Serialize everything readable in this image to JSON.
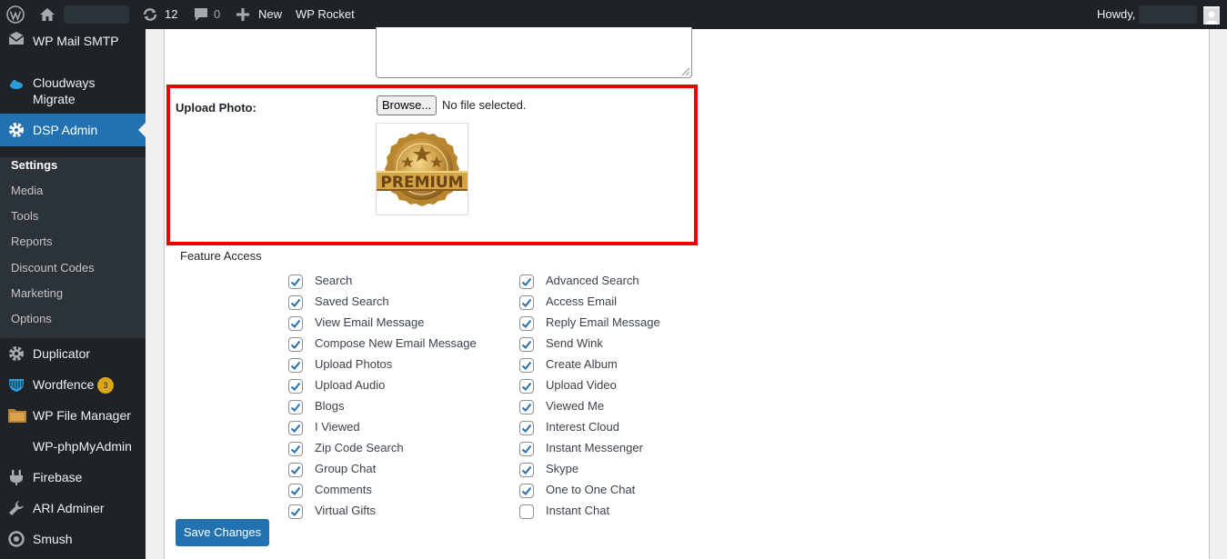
{
  "admin_bar": {
    "updates_count": "12",
    "comments_count": "0",
    "new_label": "New",
    "wp_rocket_label": "WP Rocket",
    "howdy_label": "Howdy,"
  },
  "sidebar": {
    "items": [
      {
        "label": "WP Mail SMTP",
        "icon": "mail-icon"
      },
      {
        "label": "Cloudways Migrate",
        "icon": "cloud-icon"
      },
      {
        "label": "DSP Admin",
        "icon": "gear-icon"
      },
      {
        "label": "Duplicator",
        "icon": "gear-icon"
      },
      {
        "label": "Wordfence",
        "icon": "shield-icon",
        "badge": "3"
      },
      {
        "label": "WP File Manager",
        "icon": "folder-icon"
      },
      {
        "label": "WP-phpMyAdmin",
        "icon": ""
      },
      {
        "label": "Firebase",
        "icon": "plug-icon"
      },
      {
        "label": "ARI Adminer",
        "icon": "wrench-icon"
      },
      {
        "label": "Smush",
        "icon": "smush-icon"
      }
    ],
    "submenu": [
      "Settings",
      "Media",
      "Tools",
      "Reports",
      "Discount Codes",
      "Marketing",
      "Options"
    ]
  },
  "upload": {
    "label": "Upload Photo:",
    "browse_label": "Browse...",
    "file_status": "No file selected.",
    "preview_text": "PREMIUM"
  },
  "feature_access": {
    "heading": "Feature Access",
    "left": [
      {
        "label": "Search",
        "checked": true
      },
      {
        "label": "Saved Search",
        "checked": true
      },
      {
        "label": "View Email Message",
        "checked": true
      },
      {
        "label": "Compose New Email Message",
        "checked": true
      },
      {
        "label": "Upload Photos",
        "checked": true
      },
      {
        "label": "Upload Audio",
        "checked": true
      },
      {
        "label": "Blogs",
        "checked": true
      },
      {
        "label": "I Viewed",
        "checked": true
      },
      {
        "label": "Zip Code Search",
        "checked": true
      },
      {
        "label": "Group Chat",
        "checked": true
      },
      {
        "label": "Comments",
        "checked": true
      },
      {
        "label": "Virtual Gifts",
        "checked": true
      }
    ],
    "right": [
      {
        "label": "Advanced Search",
        "checked": true
      },
      {
        "label": "Access Email",
        "checked": true
      },
      {
        "label": "Reply Email Message",
        "checked": true
      },
      {
        "label": "Send Wink",
        "checked": true
      },
      {
        "label": "Create Album",
        "checked": true
      },
      {
        "label": "Upload Video",
        "checked": true
      },
      {
        "label": "Viewed Me",
        "checked": true
      },
      {
        "label": "Interest Cloud",
        "checked": true
      },
      {
        "label": "Instant Messenger",
        "checked": true
      },
      {
        "label": "Skype",
        "checked": true
      },
      {
        "label": "One to One Chat",
        "checked": true
      },
      {
        "label": "Instant Chat",
        "checked": false
      }
    ]
  },
  "save_label": "Save Changes",
  "colors": {
    "admin_bg": "#1d2327",
    "accent": "#2271b1",
    "highlight_border": "#ee0000",
    "badge": "#dba617"
  }
}
